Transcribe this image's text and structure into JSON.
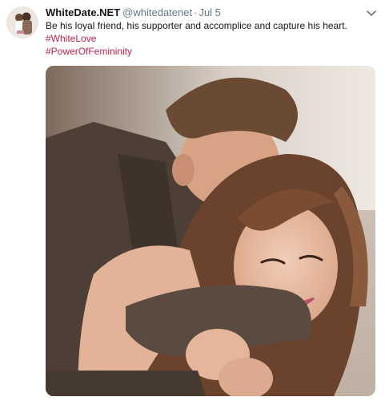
{
  "tweet": {
    "display_name": "WhiteDate.NET",
    "handle": "@whitedatenet",
    "separator": "·",
    "date": "Jul 5",
    "text": "Be his loyal friend, his supporter and accomplice and capture his heart.",
    "hashtags": [
      "#WhiteLove",
      "#PowerOfFemininity"
    ],
    "avatar_icon": "profile-avatar",
    "menu_icon": "chevron-down-icon",
    "media_description_icon": "photo-couple-embrace"
  },
  "colors": {
    "name": "#14171a",
    "secondary": "#657786",
    "hashtag": "#c0234b"
  }
}
